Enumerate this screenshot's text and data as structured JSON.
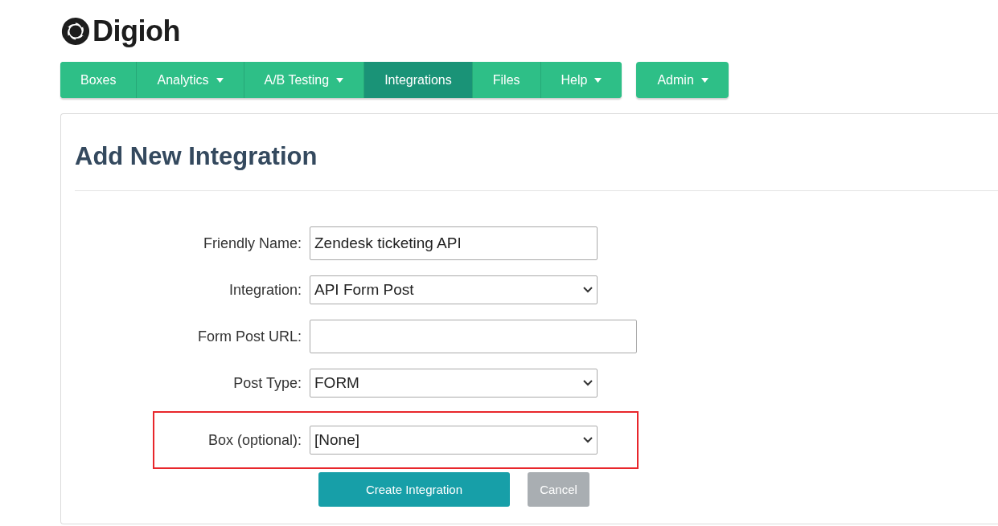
{
  "logo": {
    "text": "Digioh"
  },
  "nav": [
    {
      "label": "Boxes",
      "selected": false,
      "has_menu": false
    },
    {
      "label": "Analytics",
      "selected": false,
      "has_menu": true
    },
    {
      "label": "A/B Testing",
      "selected": false,
      "has_menu": true
    },
    {
      "label": "Integrations",
      "selected": true,
      "has_menu": false
    },
    {
      "label": "Files",
      "selected": false,
      "has_menu": false
    },
    {
      "label": "Help",
      "selected": false,
      "has_menu": true
    }
  ],
  "admin_menu": {
    "label": "Admin",
    "has_menu": true
  },
  "page_title": "Add New Integration",
  "fields": [
    {
      "label": "Friendly Name:",
      "kind": "text",
      "value": "Zendesk ticketing API",
      "highlighted": false
    },
    {
      "label": "Integration:",
      "kind": "select",
      "value": "API Form Post",
      "highlighted": false
    },
    {
      "label": "Form Post URL:",
      "kind": "url",
      "highlighted": false
    },
    {
      "label": "Post Type:",
      "kind": "select",
      "value": "FORM",
      "highlighted": false
    },
    {
      "label": "Box (optional):",
      "kind": "select",
      "value": "[None]",
      "highlighted": true
    }
  ],
  "buttons": [
    {
      "label": "Create Integration",
      "kind": "primary",
      "disabled": false
    },
    {
      "label": "Cancel",
      "kind": "secondary",
      "disabled": true
    }
  ]
}
